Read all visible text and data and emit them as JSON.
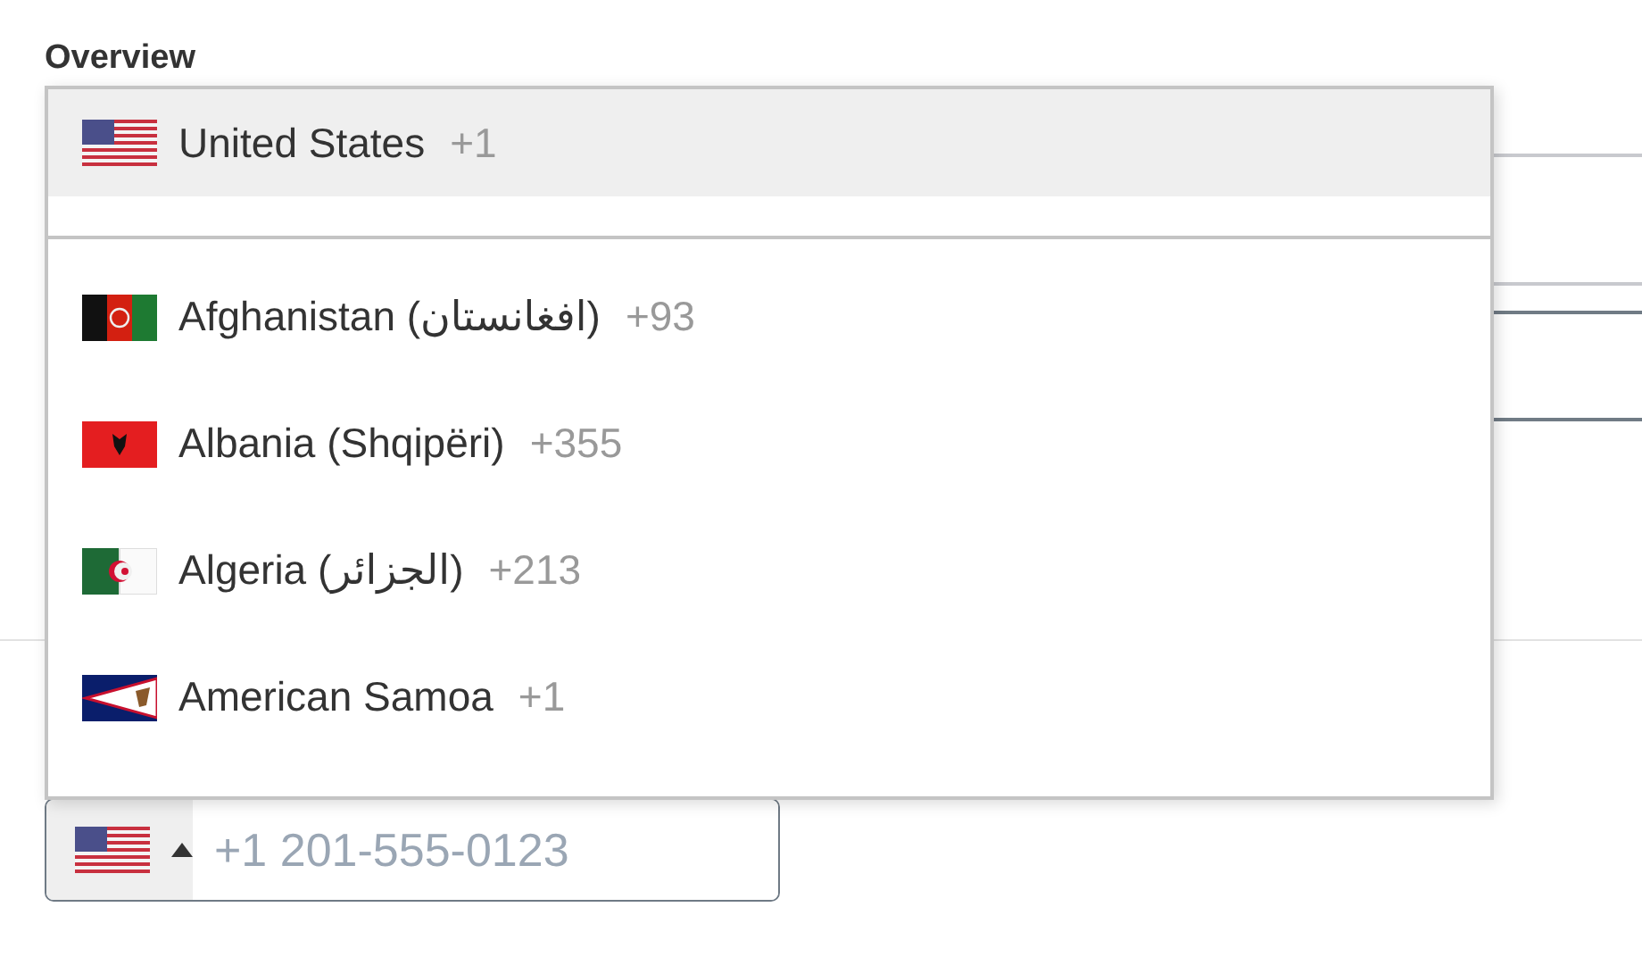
{
  "heading": "Overview",
  "phone_input": {
    "placeholder": "+1 201-555-0123",
    "dropdown_expanded": true
  },
  "country_list": {
    "preferred": [
      {
        "name": "United States",
        "code": "+1",
        "kind": "us",
        "selected": true
      }
    ],
    "countries": [
      {
        "name": "Afghanistan (افغانستان)",
        "code": "+93",
        "kind": "af",
        "selected": false
      },
      {
        "name": "Albania (Shqipëri)",
        "code": "+355",
        "kind": "al",
        "selected": false
      },
      {
        "name": "Algeria (الجزائر)",
        "code": "+213",
        "kind": "dz",
        "selected": false
      },
      {
        "name": "American Samoa",
        "code": "+1",
        "kind": "as",
        "selected": false
      }
    ]
  }
}
